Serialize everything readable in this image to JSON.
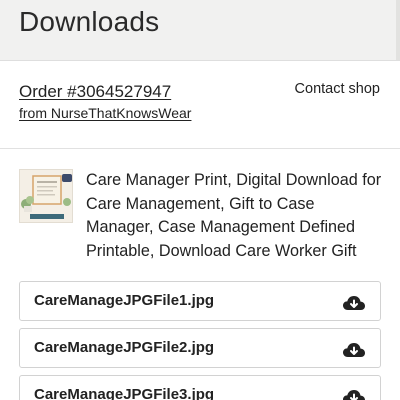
{
  "page": {
    "title": "Downloads"
  },
  "order": {
    "number": "Order #3064527947",
    "shop": "from NurseThatKnowsWear",
    "contact_label": "Contact shop"
  },
  "product": {
    "title": "Care Manager Print, Digital Download for Care Management, Gift to Case Manager, Case Management Defined Printable, Download Care Worker Gift",
    "thumbnail_icon": "product-thumbnail"
  },
  "files": [
    {
      "name": "CareManageJPGFile1.jpg",
      "icon": "cloud-download-icon"
    },
    {
      "name": "CareManageJPGFile2.jpg",
      "icon": "cloud-download-icon"
    },
    {
      "name": "CareManageJPGFile3.jpg",
      "icon": "cloud-download-icon"
    }
  ],
  "colors": {
    "background": "#f1f1f0",
    "card": "#ffffff",
    "text": "#222222",
    "border": "#d2d2d2"
  }
}
